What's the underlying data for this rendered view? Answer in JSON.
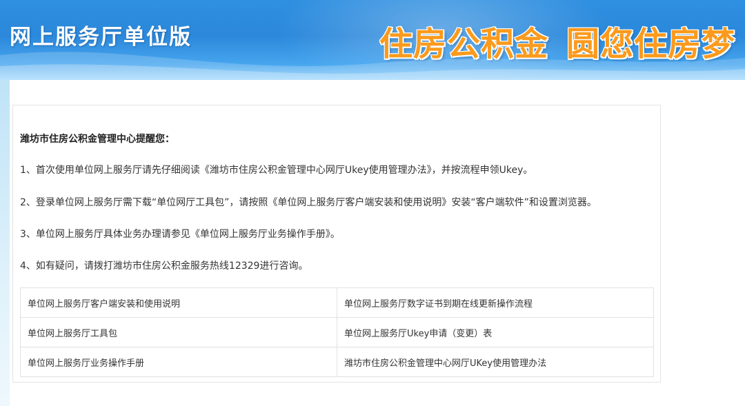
{
  "header": {
    "title": "网上服务厅单位版",
    "slogan_left": "住房公积金",
    "slogan_right": "圆您住房梦"
  },
  "notice": {
    "heading": "潍坊市住房公积金管理中心提醒您：",
    "items": [
      "1、首次使用单位网上服务厅请先仔细阅读《潍坊市住房公积金管理中心网厅Ukey使用管理办法》，并按流程申领Ukey。",
      "2、登录单位网上服务厅需下载“单位网厅工具包”，请按照《单位网上服务厅客户端安装和使用说明》安装“客户端软件”和设置浏览器。",
      "3、单位网上服务厅具体业务办理请参见《单位网上服务厅业务操作手册》。",
      "4、如有疑问，请拨打潍坊市住房公积金服务热线12329进行咨询。"
    ]
  },
  "links": [
    [
      "单位网上服务厅客户端安装和使用说明",
      "单位网上服务厅数字证书到期在线更新操作流程"
    ],
    [
      "单位网上服务厅工具包",
      "单位网上服务厅Ukey申请（变更）表"
    ],
    [
      "单位网上服务厅业务操作手册",
      "潍坊市住房公积金管理中心网厅UKey使用管理办法"
    ]
  ],
  "colors": {
    "banner_blue": "#2b88db",
    "slogan_orange": "#fb9a1c"
  }
}
